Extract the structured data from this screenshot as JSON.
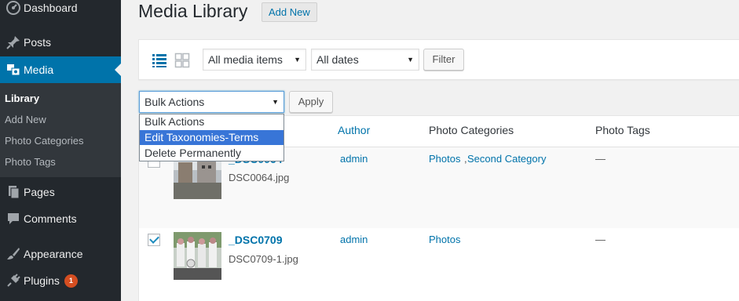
{
  "sidebar": {
    "items": [
      {
        "label": "Dashboard",
        "icon": "dashboard-icon"
      },
      {
        "label": "Posts",
        "icon": "pin-icon"
      },
      {
        "label": "Media",
        "icon": "media-icon"
      },
      {
        "label": "Pages",
        "icon": "pages-icon"
      },
      {
        "label": "Comments",
        "icon": "comment-icon"
      },
      {
        "label": "Appearance",
        "icon": "brush-icon"
      },
      {
        "label": "Plugins",
        "icon": "plugin-icon",
        "badge": "1"
      }
    ],
    "submenu": [
      "Library",
      "Add New",
      "Photo Categories",
      "Photo Tags"
    ]
  },
  "header": {
    "title": "Media Library",
    "add_new": "Add New"
  },
  "filters": {
    "media_type": "All media items",
    "dates": "All dates",
    "filter_btn": "Filter"
  },
  "bulk": {
    "selected": "Bulk Actions",
    "apply_btn": "Apply",
    "options": [
      "Bulk Actions",
      "Edit Taxonomies-Terms",
      "Delete Permanently"
    ],
    "highlighted_index": 1
  },
  "table": {
    "columns": [
      "Author",
      "Photo Categories",
      "Photo Tags"
    ],
    "rows": [
      {
        "title": "_DSC0064",
        "file": "DSC0064.jpg",
        "author": "admin",
        "categories": [
          "Photos",
          "Second Category"
        ],
        "tags": "—",
        "checked": false
      },
      {
        "title": "_DSC0709",
        "file": "DSC0709-1.jpg",
        "author": "admin",
        "categories": [
          "Photos"
        ],
        "tags": "—",
        "checked": true
      }
    ]
  },
  "colors": {
    "sidebar_bg": "#23282d",
    "accent": "#0073aa",
    "highlight": "#3875d7"
  }
}
